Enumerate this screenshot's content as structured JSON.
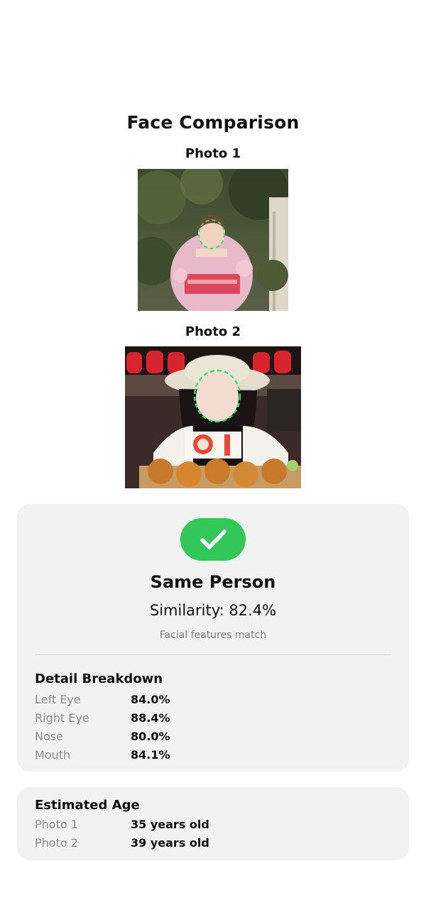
{
  "page_title": "Face Comparison",
  "photos": [
    {
      "label": "Photo 1",
      "image": "woman-in-pink-kimono-with-face-outline"
    },
    {
      "label": "Photo 2",
      "image": "woman-with-hat-and-takoyaki-with-face-outline"
    }
  ],
  "result": {
    "icon": "checkmark-icon",
    "verdict": "Same Person",
    "similarity": "Similarity: 82.4%",
    "note": "Facial features match",
    "accent_color": "#33c759"
  },
  "breakdown": {
    "title": "Detail Breakdown",
    "rows": [
      {
        "label": "Left Eye",
        "value": "84.0%"
      },
      {
        "label": "Right Eye",
        "value": "88.4%"
      },
      {
        "label": "Nose",
        "value": "80.0%"
      },
      {
        "label": "Mouth",
        "value": "84.1%"
      }
    ]
  },
  "age": {
    "title": "Estimated Age",
    "rows": [
      {
        "label": "Photo 1",
        "value": "35 years old"
      },
      {
        "label": "Photo 2",
        "value": "39 years old"
      }
    ]
  }
}
